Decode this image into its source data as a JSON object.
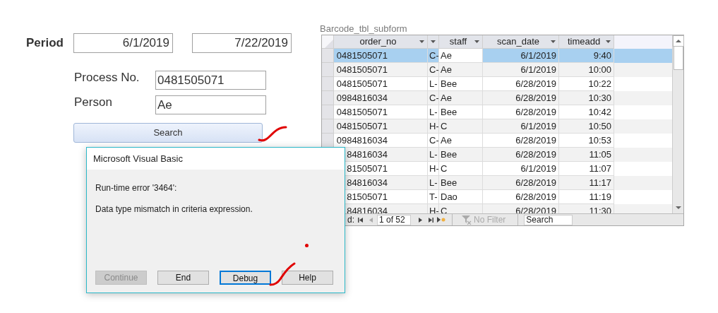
{
  "form": {
    "period": {
      "label": "Period",
      "from": "6/1/2019",
      "to": "7/22/2019"
    },
    "fields": [
      {
        "label": "Process No.",
        "value": "0481505071"
      },
      {
        "label": "Person",
        "value": "Ae"
      }
    ],
    "search_button": "Search"
  },
  "subform": {
    "caption": "Barcode_tbl_subform",
    "columns": [
      "order_no",
      "",
      "staff",
      "scan_date",
      "timeadd"
    ],
    "rows": [
      {
        "cells": [
          "0481505071",
          "C-",
          "Ae",
          "6/1/2019",
          "9:40"
        ],
        "selected": true
      },
      {
        "cells": [
          "0481505071",
          "C-",
          "Ae",
          "6/1/2019",
          "10:00"
        ],
        "selected": false
      },
      {
        "cells": [
          "0481505071",
          "L-",
          "Bee",
          "6/28/2019",
          "10:22"
        ],
        "selected": false
      },
      {
        "cells": [
          "0984816034",
          "C-",
          "Ae",
          "6/28/2019",
          "10:30"
        ],
        "selected": false
      },
      {
        "cells": [
          "0481505071",
          "L-",
          "Bee",
          "6/28/2019",
          "10:42"
        ],
        "selected": false
      },
      {
        "cells": [
          "0481505071",
          "H-",
          "C",
          "6/1/2019",
          "10:50"
        ],
        "selected": false
      },
      {
        "cells": [
          "0984816034",
          "C-",
          "Ae",
          "6/28/2019",
          "10:53"
        ],
        "selected": false
      },
      {
        "cells": [
          "84816034",
          "L-",
          "Bee",
          "6/28/2019",
          "11:05"
        ],
        "selected": false
      },
      {
        "cells": [
          "81505071",
          "H-",
          "C",
          "6/1/2019",
          "11:07"
        ],
        "selected": false
      },
      {
        "cells": [
          "84816034",
          "L-",
          "Bee",
          "6/28/2019",
          "11:17"
        ],
        "selected": false
      },
      {
        "cells": [
          "81505071",
          "T-",
          "Dao",
          "6/28/2019",
          "11:19"
        ],
        "selected": false
      },
      {
        "cells": [
          "84816034",
          "H-",
          "C",
          "6/28/2019",
          "11:30"
        ],
        "selected": false
      }
    ],
    "navigation": {
      "label": "d:",
      "record": "1 of 52",
      "filter": "No Filter",
      "search": "Search"
    }
  },
  "dialog": {
    "title": "Microsoft Visual Basic",
    "error": "Run-time error '3464':",
    "message": "Data type mismatch in criteria expression.",
    "buttons": [
      {
        "label": "Continue",
        "disabled": true,
        "selected": false
      },
      {
        "label": "End",
        "disabled": false,
        "selected": false
      },
      {
        "label": "Debug",
        "disabled": false,
        "selected": true
      },
      {
        "label": "Help",
        "disabled": false,
        "selected": false
      }
    ]
  }
}
